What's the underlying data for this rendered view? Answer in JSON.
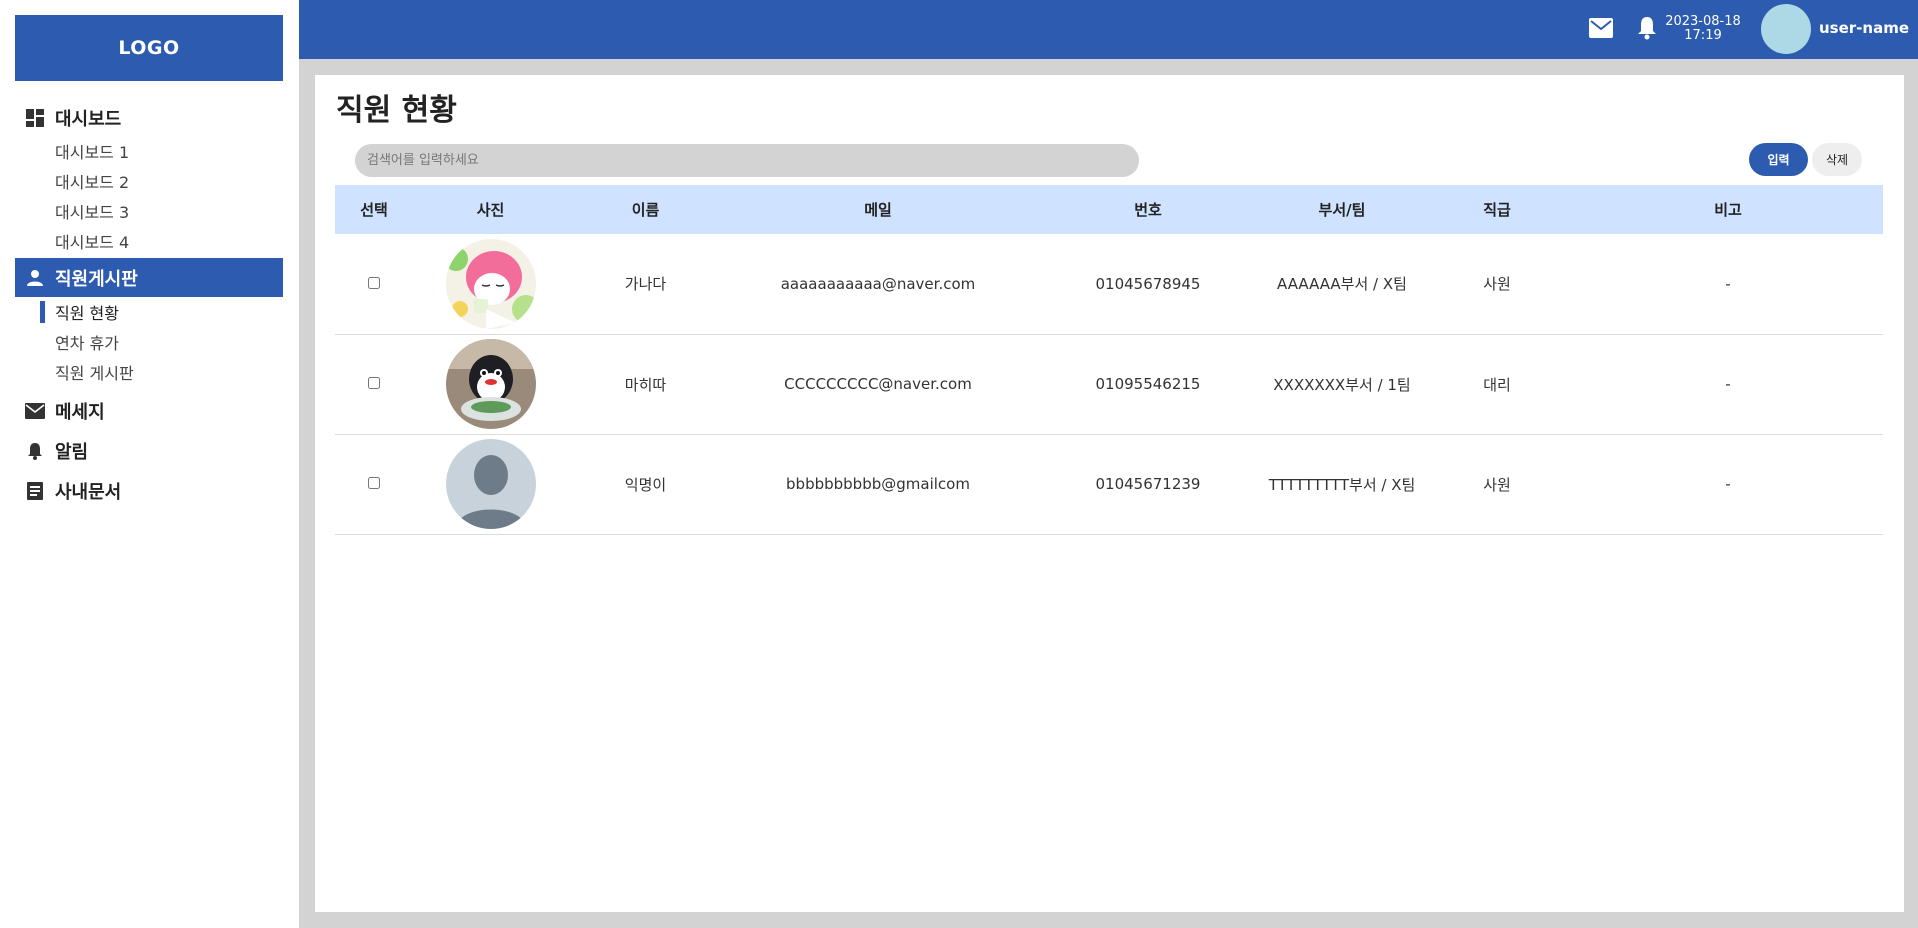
{
  "logo": "LOGO",
  "sidebar": {
    "dashboard": {
      "label": "대시보드",
      "items": [
        "대시보드 1",
        "대시보드 2",
        "대시보드 3",
        "대시보드 4"
      ]
    },
    "staff_board": {
      "label": "직원게시판",
      "items": [
        "직원 현황",
        "연차 휴가",
        "직원 게시판"
      ]
    },
    "messages": "메세지",
    "alerts": "알림",
    "documents": "사내문서"
  },
  "header": {
    "date": "2023-08-18",
    "time": "17:19",
    "username": "user-name"
  },
  "page": {
    "title": "직원 현황",
    "search_placeholder": "검색어를 입력하세요",
    "add_label": "입력",
    "delete_label": "삭제"
  },
  "table": {
    "headers": [
      "선택",
      "사진",
      "이름",
      "메일",
      "번호",
      "부서/팀",
      "직급",
      "비고"
    ],
    "rows": [
      {
        "name": "가나다",
        "email": "aaaaaaaaaaa@naver.com",
        "phone": "01045678945",
        "dept": "AAAAAA부서 / X팀",
        "rank": "사원",
        "note": "-"
      },
      {
        "name": "마히따",
        "email": "CCCCCCCCC@naver.com",
        "phone": "01095546215",
        "dept": "XXXXXXX부서 / 1팀",
        "rank": "대리",
        "note": "-"
      },
      {
        "name": "익명이",
        "email": "bbbbbbbbbb@gmailcom",
        "phone": "01045671239",
        "dept": "TTTTTTTTT부서 / X팀",
        "rank": "사원",
        "note": "-"
      }
    ]
  },
  "colors": {
    "brand": "#2d5bb0",
    "table_header": "#cfe2ff",
    "avatar": "#add8e6",
    "background": "#d3d3d3"
  }
}
